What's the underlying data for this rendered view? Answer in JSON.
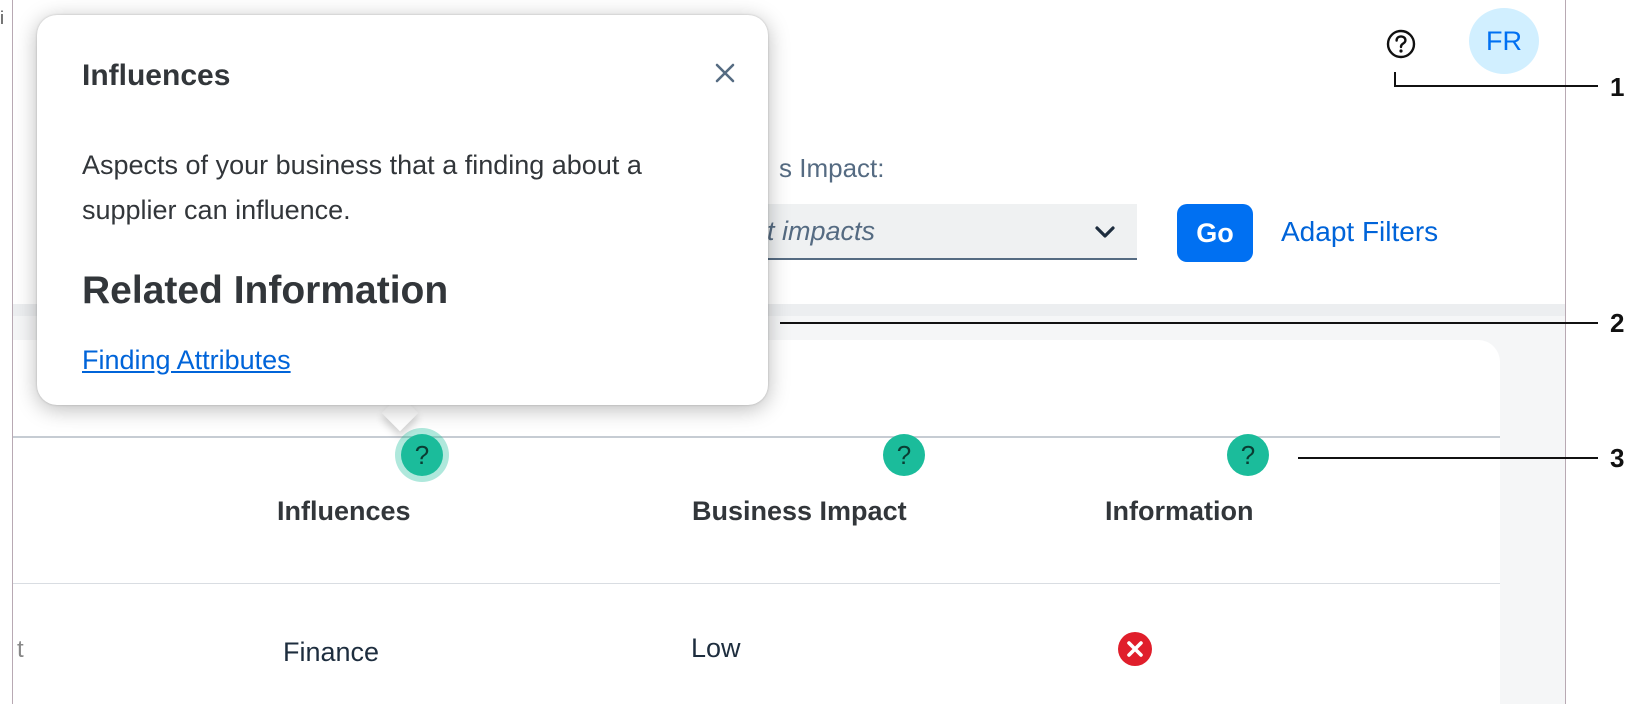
{
  "header": {
    "help_icon": "help-circle-icon",
    "avatar_initials": "FR"
  },
  "filters": {
    "impact_label": "s Impact:",
    "impact_placeholder": "t impacts",
    "go_label": "Go",
    "adapt_filters_label": "Adapt Filters"
  },
  "popover": {
    "title": "Influences",
    "body": "Aspects of your business that a finding about a supplier can influence.",
    "related_heading": "Related Information",
    "related_link": "Finding Attributes"
  },
  "table": {
    "columns": [
      {
        "label": "Influences",
        "help": "?"
      },
      {
        "label": "Business Impact",
        "help": "?"
      },
      {
        "label": "Information",
        "help": "?"
      }
    ],
    "rows": [
      {
        "influences": "Finance",
        "business_impact": "Low",
        "information_icon": "error-icon"
      }
    ],
    "row_edge_glyph": "t"
  },
  "callouts": [
    "1",
    "2",
    "3"
  ],
  "edge_glyph": "i",
  "colors": {
    "accent": "#0070f2",
    "link": "#0064d9",
    "help_badge": "#1bbc9b",
    "error": "#e01e2b",
    "avatar_bg": "#d1efff"
  }
}
